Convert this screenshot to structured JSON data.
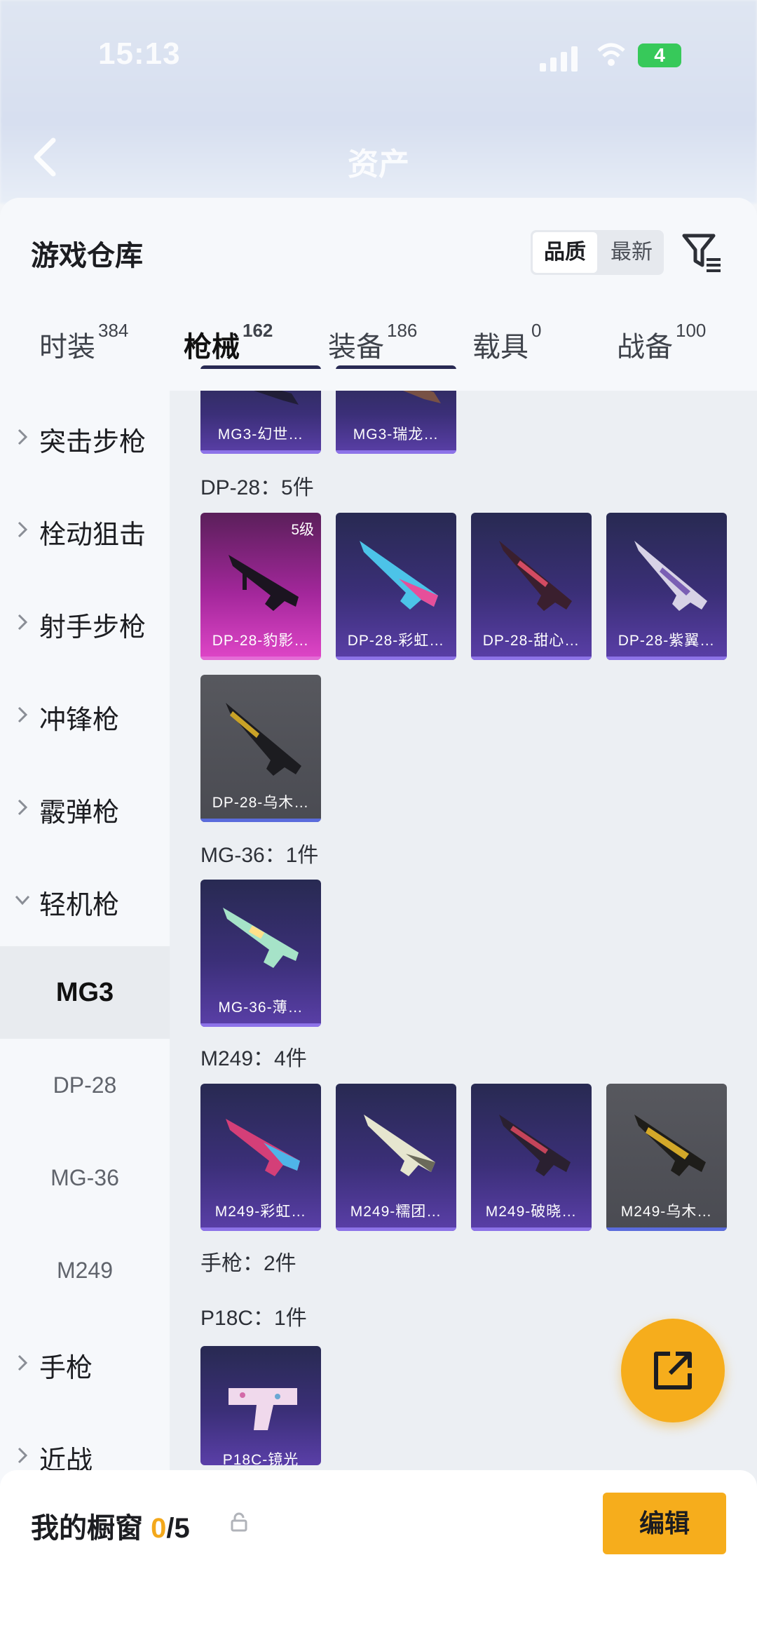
{
  "status_bar": {
    "time": "15:13",
    "battery": "4"
  },
  "nav": {
    "title": "资产"
  },
  "warehouse": {
    "title": "游戏仓库",
    "sort_options": [
      "品质",
      "最新"
    ],
    "sort_selected": "品质"
  },
  "tabs": [
    {
      "label": "时装",
      "count": "384"
    },
    {
      "label": "枪械",
      "count": "162",
      "active": true
    },
    {
      "label": "装备",
      "count": "186"
    },
    {
      "label": "载具",
      "count": "0"
    },
    {
      "label": "战备",
      "count": "100"
    }
  ],
  "categories": [
    {
      "label": "突击步枪"
    },
    {
      "label": "栓动狙击"
    },
    {
      "label": "射手步枪"
    },
    {
      "label": "冲锋枪"
    },
    {
      "label": "霰弹枪"
    },
    {
      "label": "轻机枪",
      "expanded": true
    },
    {
      "label": "手枪"
    },
    {
      "label": "近战"
    }
  ],
  "subcategories": [
    {
      "label": "MG3",
      "selected": true
    },
    {
      "label": "DP-28"
    },
    {
      "label": "MG-36"
    },
    {
      "label": "M249"
    }
  ],
  "sections": [
    {
      "title": "DP-28：5件"
    },
    {
      "title": "MG-36：1件"
    },
    {
      "title": "M249：4件"
    },
    {
      "title": "手枪：2件"
    },
    {
      "title": "P18C：1件"
    }
  ],
  "items": {
    "mg3": [
      {
        "name": "MG3-幻世…",
        "rarity": "purple"
      },
      {
        "name": "MG3-瑞龙…",
        "rarity": "purple"
      }
    ],
    "dp28": [
      {
        "name": "DP-28-豹影…",
        "rarity": "pink",
        "level": "5级"
      },
      {
        "name": "DP-28-彩虹…",
        "rarity": "purple"
      },
      {
        "name": "DP-28-甜心…",
        "rarity": "purple"
      },
      {
        "name": "DP-28-紫翼…",
        "rarity": "purple"
      },
      {
        "name": "DP-28-乌木…",
        "rarity": "grey"
      }
    ],
    "mg36": [
      {
        "name": "MG-36-薄…",
        "rarity": "purple"
      }
    ],
    "m249": [
      {
        "name": "M249-彩虹…",
        "rarity": "purple"
      },
      {
        "name": "M249-糯团…",
        "rarity": "purple"
      },
      {
        "name": "M249-破晓…",
        "rarity": "purple"
      },
      {
        "name": "M249-乌木…",
        "rarity": "grey"
      }
    ],
    "p18c": [
      {
        "name": "P18C-镜光",
        "rarity": "purple"
      }
    ]
  },
  "showcase": {
    "label": "我的橱窗",
    "current": "0",
    "total": "/5"
  },
  "buttons": {
    "edit": "编辑"
  },
  "colors": {
    "accent": "#f6ad1c",
    "purple_card": "#3b2f78",
    "pink_card": "#a3279b",
    "grey_card": "#4a4b52"
  }
}
